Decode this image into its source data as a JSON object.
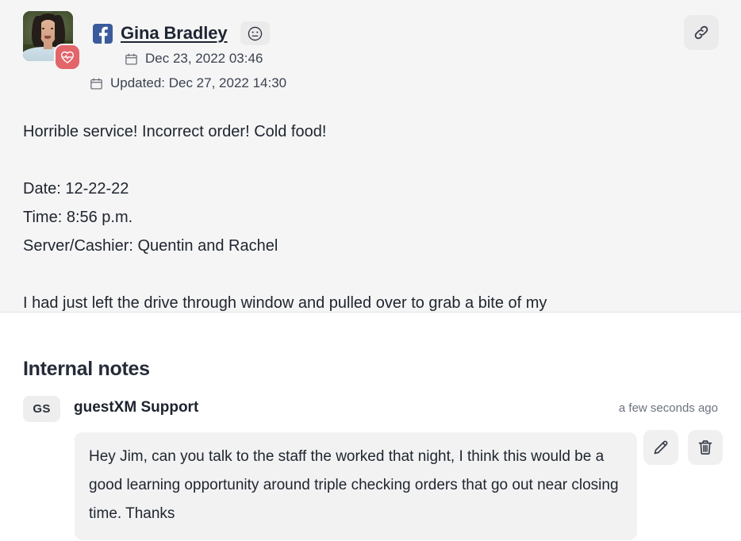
{
  "review": {
    "source_icon": "facebook-icon",
    "author_name": "Gina Bradley",
    "sentiment_icon": "neutral-face-icon",
    "avatar_badge_icon": "heart-pulse-icon",
    "created_label": "Dec 23, 2022 03:46",
    "updated_label": "Updated: Dec 27, 2022 14:30",
    "link_icon": "chain-link-icon",
    "body": {
      "headline": "Horrible service! Incorrect order! Cold food!",
      "date_line": "Date: 12-22-22",
      "time_line": "Time: 8:56 p.m.",
      "server_line": "Server/Cashier: Quentin and Rachel",
      "clipped_line": "I had just left the drive through window and pulled over to grab a bite of my"
    }
  },
  "internal_notes": {
    "title": "Internal notes",
    "entries": [
      {
        "initials": "GS",
        "author": "guestXM Support",
        "timestamp": "a few seconds ago",
        "text": "Hey Jim, can you talk to the staff the worked that night, I think this would be a good learning opportunity around triple checking orders that go out near closing time. Thanks",
        "edit_icon": "pencil-icon",
        "delete_icon": "trash-icon"
      }
    ]
  },
  "colors": {
    "panel_background": "#f5f5f6",
    "notes_background": "#ffffff",
    "facebook_blue": "#3a5a9b",
    "badge_red": "#e2656a",
    "bubble_gray": "#f2f2f3",
    "text_dark": "#20262f",
    "text_muted": "#6d7280"
  }
}
